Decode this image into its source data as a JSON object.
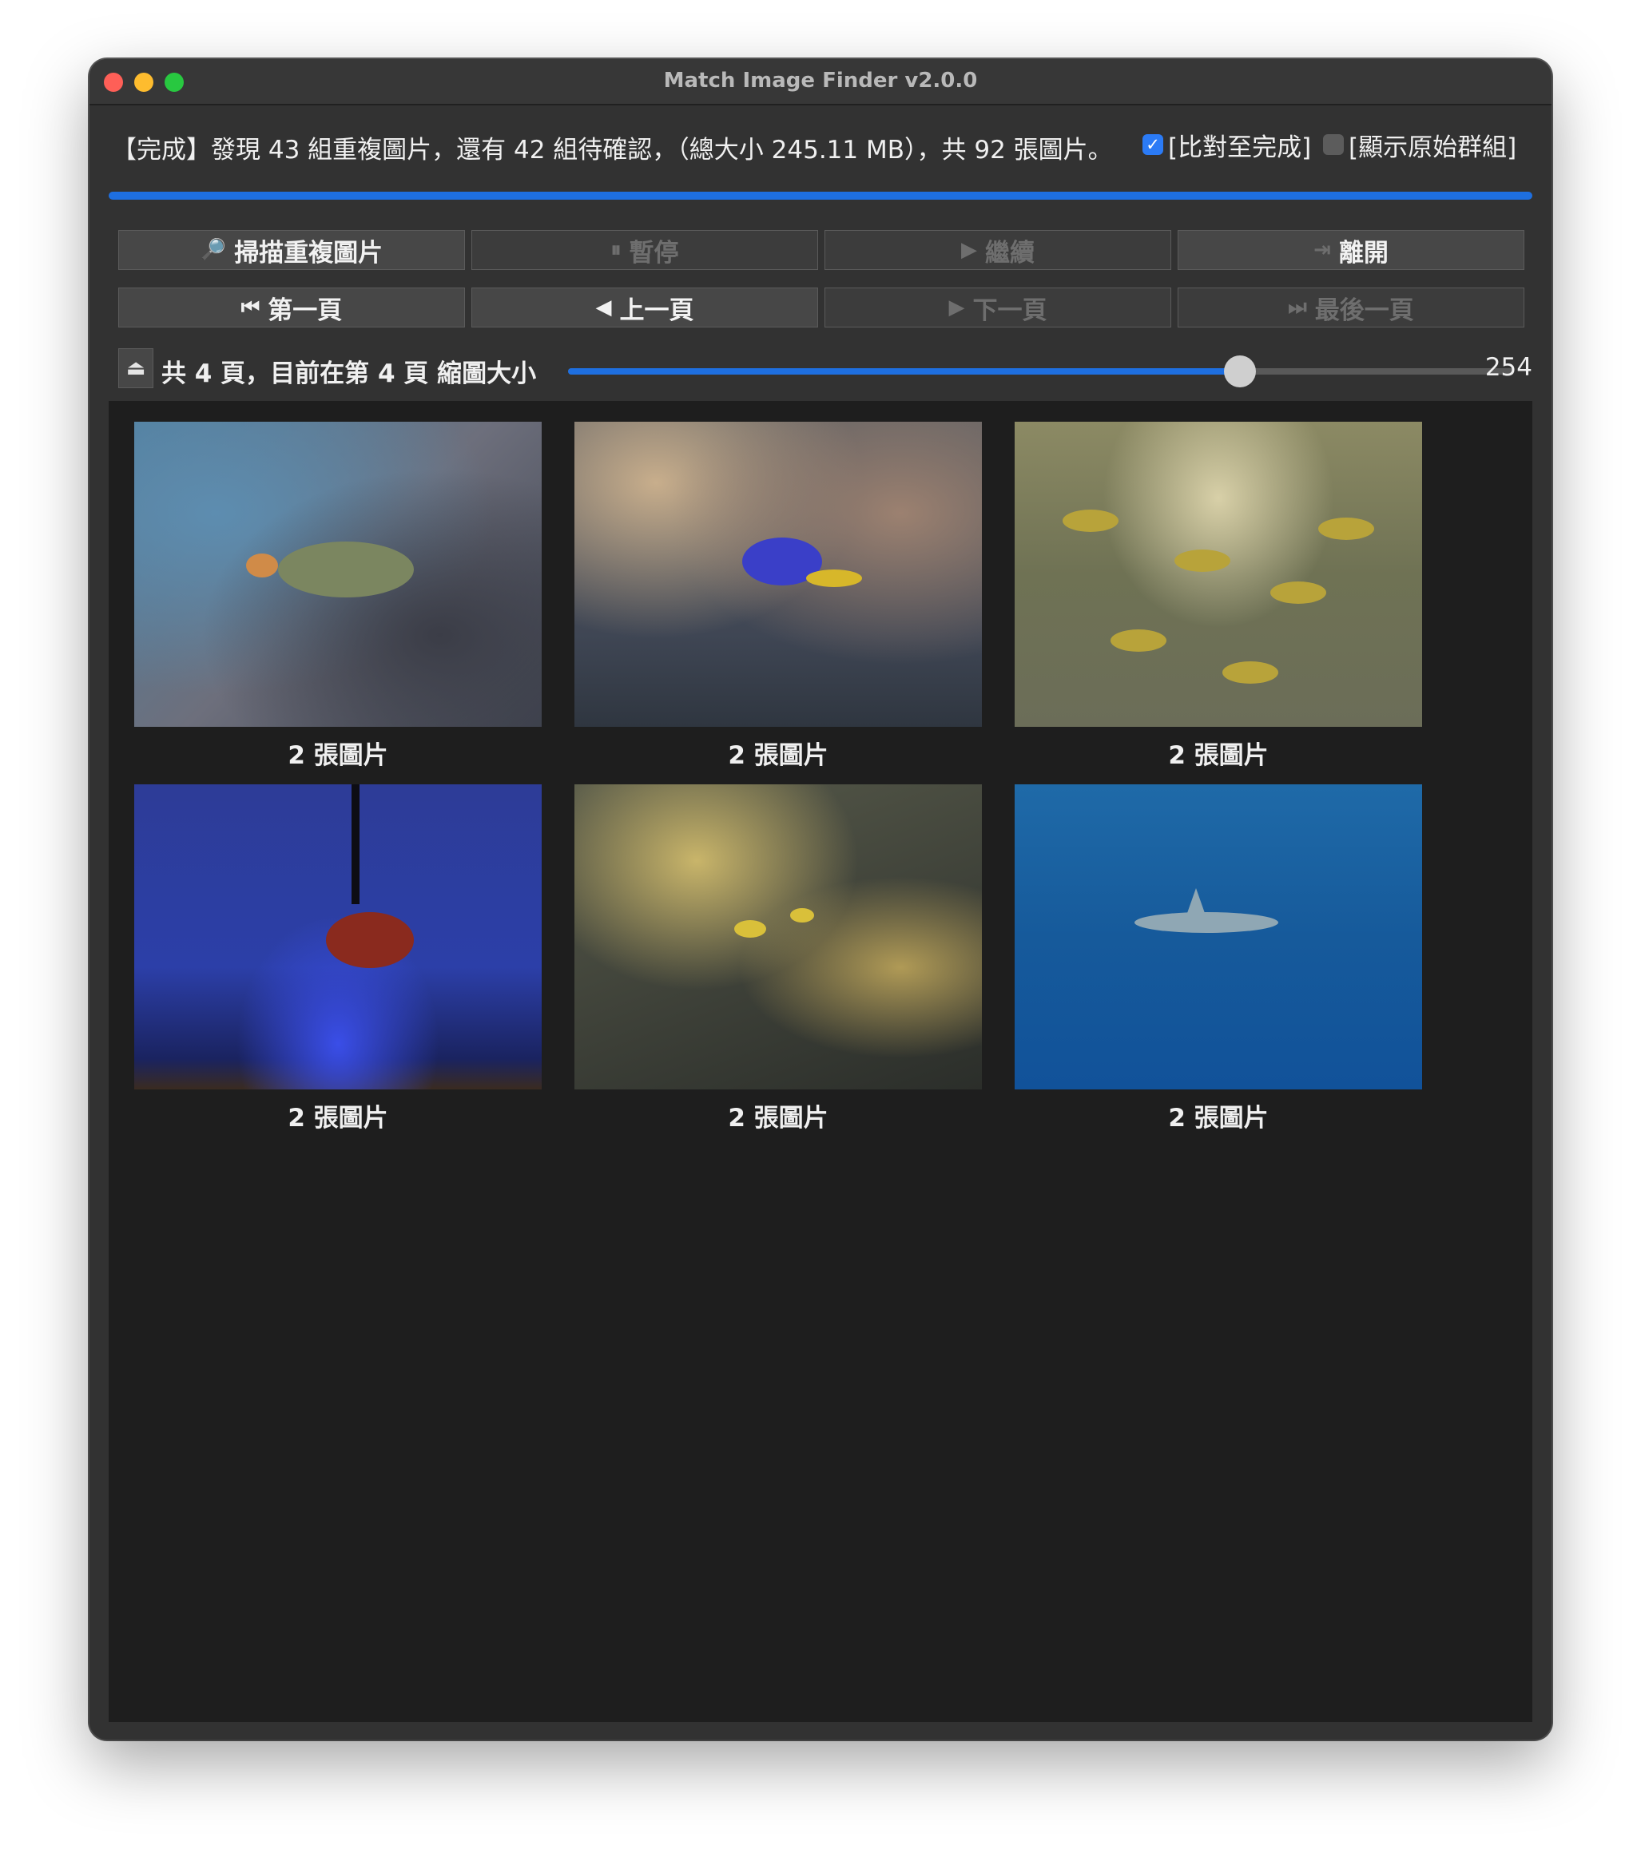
{
  "window": {
    "title": "Match Image Finder v2.0.0"
  },
  "status": {
    "text": "【完成】發現 43 組重複圖片，還有 42 組待確認，（總大小 245.11 MB），共 92 張圖片。",
    "compare_label": "[比對至完成]",
    "compare_checked": true,
    "show_groups_label": "[顯示原始群組]",
    "show_groups_checked": false,
    "progress_percent": 100
  },
  "toolbar": {
    "scan_label": "掃描重複圖片",
    "pause_label": "暫停",
    "resume_label": "繼續",
    "exit_label": "離開",
    "first_page_label": "第一頁",
    "prev_page_label": "上一頁",
    "next_page_label": "下一頁",
    "last_page_label": "最後一頁"
  },
  "pager": {
    "info": "共 4 頁，目前在第 4 頁",
    "thumb_size_label": "縮圖大小",
    "thumb_size_value": "254",
    "thumb_size_fraction": 0.71
  },
  "gallery": {
    "items": [
      {
        "caption": "2 張圖片",
        "icon": "parrotfish-photo"
      },
      {
        "caption": "2 張圖片",
        "icon": "blue-damselfish-photo"
      },
      {
        "caption": "2 張圖片",
        "icon": "yellow-school-fish-photo"
      },
      {
        "caption": "2 張圖片",
        "icon": "clownfish-tank-photo"
      },
      {
        "caption": "2 張圖片",
        "icon": "reef-yellow-fish-photo"
      },
      {
        "caption": "2 張圖片",
        "icon": "shark-photo"
      }
    ]
  },
  "colors": {
    "accent": "#1e6fe0",
    "window_bg": "#323232",
    "gallery_bg": "#1e1e1e"
  }
}
